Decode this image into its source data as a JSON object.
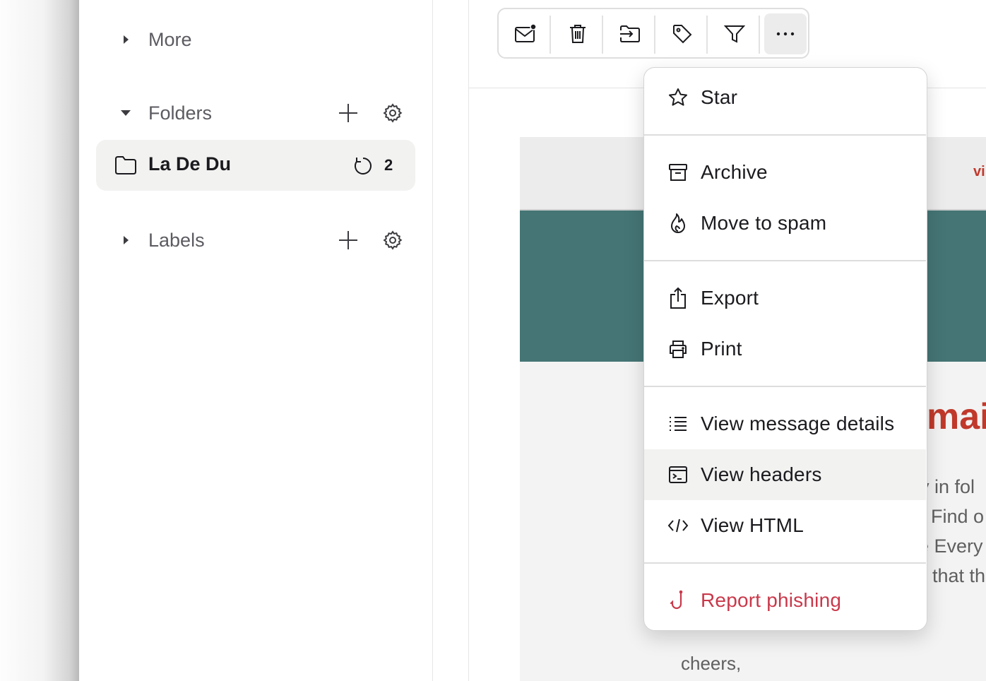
{
  "sidebar": {
    "more_label": "More",
    "folders_label": "Folders",
    "labels_label": "Labels",
    "folder_item": {
      "name": "La De Du",
      "count": "2"
    }
  },
  "toolbar": {
    "buttons": [
      "mark-unread",
      "delete",
      "move-to-folder",
      "label",
      "filter",
      "more-options"
    ]
  },
  "email_preview": {
    "link_fragment": "vi",
    "heading_fragment": "mai",
    "line1": "y in fol",
    "line2": "Find o",
    "line3": "e Every",
    "line4": "that th",
    "signoff": "cheers,"
  },
  "menu": {
    "star": "Star",
    "archive": "Archive",
    "move_to_spam": "Move to spam",
    "export": "Export",
    "print": "Print",
    "view_message_details": "View message details",
    "view_headers": "View headers",
    "view_html": "View HTML",
    "report_phishing": "Report phishing"
  },
  "colors": {
    "accent_danger": "#c9394b",
    "banner": "#457575",
    "heading_red": "#c0392b"
  }
}
